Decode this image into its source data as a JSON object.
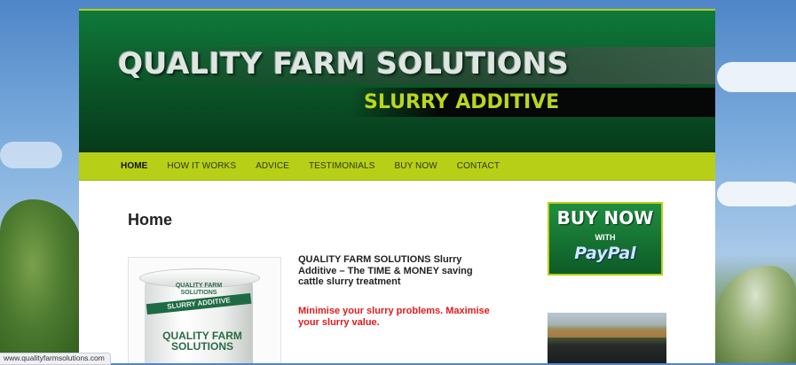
{
  "banner": {
    "title": "QUALITY FARM SOLUTIONS",
    "subtitle": "SLURRY ADDITIVE"
  },
  "nav": {
    "items": [
      {
        "label": "HOME",
        "active": true
      },
      {
        "label": "HOW IT WORKS",
        "active": false
      },
      {
        "label": "ADVICE",
        "active": false
      },
      {
        "label": "TESTIMONIALS",
        "active": false
      },
      {
        "label": "BUY NOW",
        "active": false
      },
      {
        "label": "CONTACT",
        "active": false
      }
    ]
  },
  "main": {
    "heading": "Home",
    "intro": "QUALITY FARM SOLUTIONS Slurry Additive – The TIME & MONEY saving cattle slurry treatment",
    "highlight": "Minimise your slurry problems. Maximise your slurry value.",
    "product_image": {
      "label_top": "QUALITY FARM SOLUTIONS",
      "strip": "SLURRY ADDITIVE",
      "brand": "QUALITY FARM SOLUTIONS"
    }
  },
  "sidebar": {
    "buy_now": {
      "line1": "BUY NOW",
      "line2": "WITH",
      "line3": "PayPal"
    }
  },
  "statusbar": {
    "url": "www.qualityfarmsolutions.com"
  },
  "colors": {
    "nav_bg": "#b8cf17",
    "banner_green": "#0b5a2a",
    "subtitle": "#bcd51d",
    "highlight_red": "#e11a1a"
  }
}
